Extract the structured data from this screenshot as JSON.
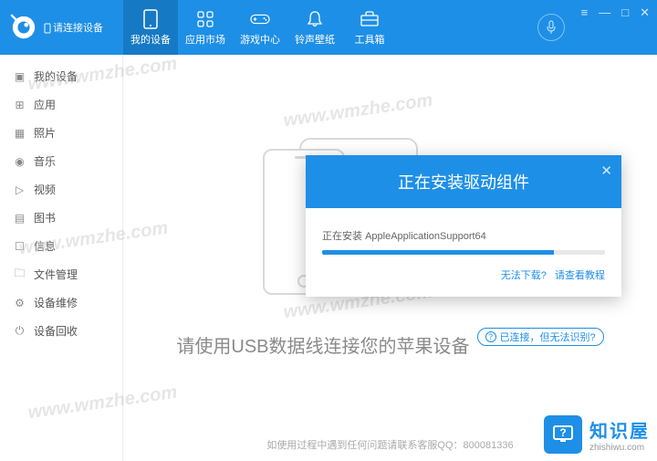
{
  "header": {
    "connect_prompt": "请连接设备",
    "nav": [
      {
        "label": "我的设备"
      },
      {
        "label": "应用市场"
      },
      {
        "label": "游戏中心"
      },
      {
        "label": "铃声壁纸"
      },
      {
        "label": "工具箱"
      }
    ]
  },
  "sidebar": {
    "items": [
      {
        "label": "我的设备"
      },
      {
        "label": "应用"
      },
      {
        "label": "照片"
      },
      {
        "label": "音乐"
      },
      {
        "label": "视频"
      },
      {
        "label": "图书"
      },
      {
        "label": "信息"
      },
      {
        "label": "文件管理"
      },
      {
        "label": "设备维修"
      },
      {
        "label": "设备回收"
      }
    ]
  },
  "main": {
    "prompt": "请使用USB数据线连接您的苹果设备",
    "status_badge": "已连接，但无法识别?",
    "footer": "如使用过程中遇到任何问题请联系客服QQ：800081336"
  },
  "dialog": {
    "title": "正在安装驱动组件",
    "installing_prefix": "正在安装",
    "installing_item": "AppleApplicationSupport64",
    "link_cant_download": "无法下载?",
    "link_tutorial": "请查看教程"
  },
  "watermarks": [
    "www.wmzhe.com",
    "www.wmzhe.com",
    "www.wmzhe.com",
    "www.wmzhe.com",
    "www.wmzhe.com"
  ],
  "brand": {
    "title": "知识屋",
    "sub": "zhishiwu.com"
  }
}
